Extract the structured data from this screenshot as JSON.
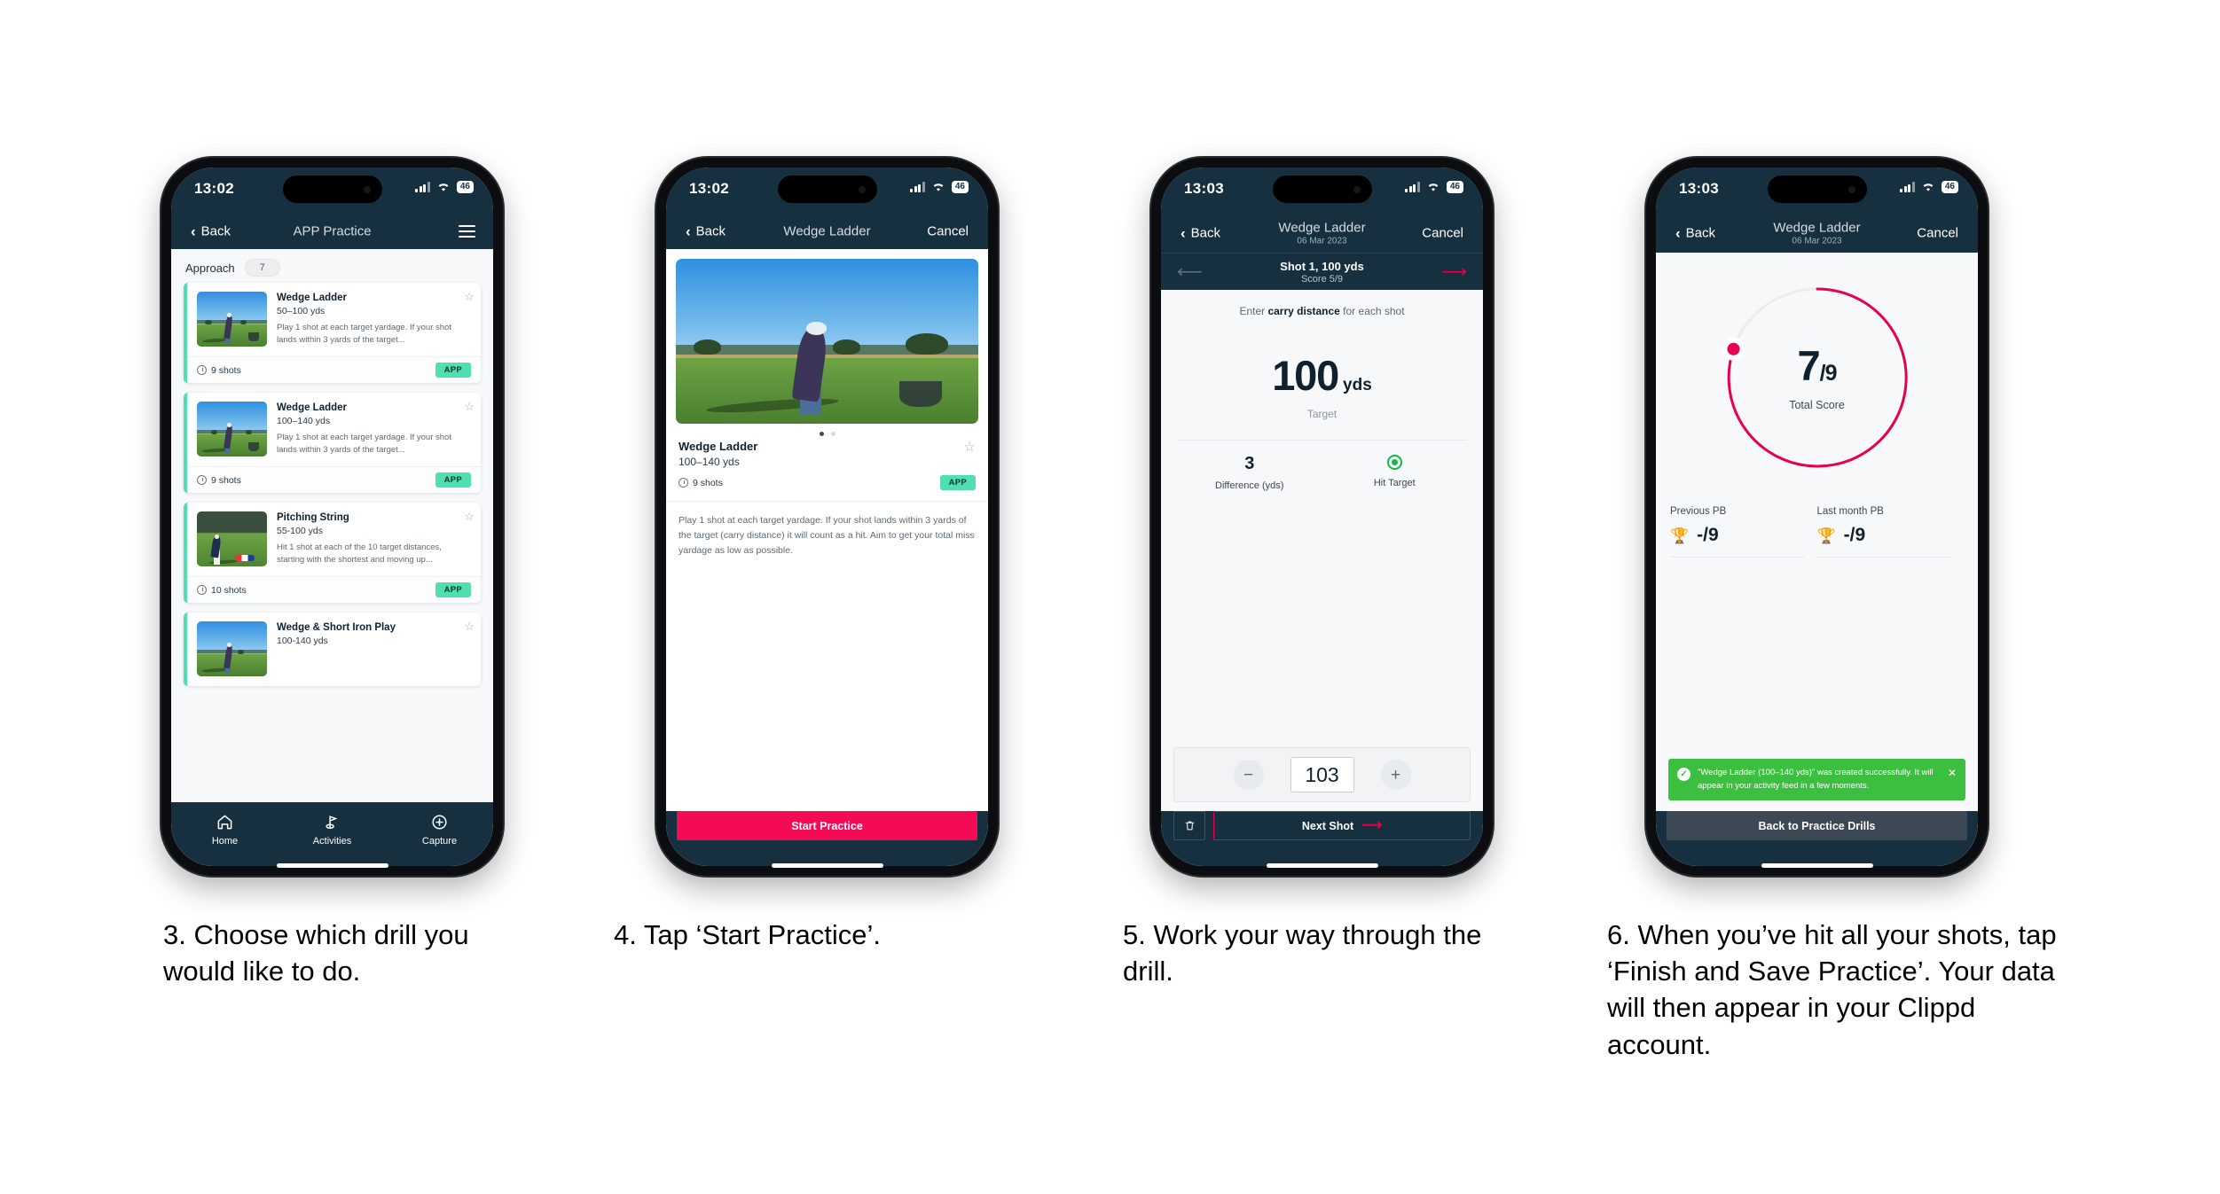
{
  "phones": [
    {
      "id": "phone-1",
      "status": {
        "time": "13:02",
        "battery": "46"
      },
      "nav": {
        "back": "Back",
        "title": "APP Practice",
        "menu_icon": "hamburger-menu-icon"
      },
      "category": {
        "label": "Approach",
        "count": "7"
      },
      "cards": [
        {
          "title": "Wedge Ladder",
          "yardage": "50–100 yds",
          "description": "Play 1 shot at each target yardage. If your shot lands within 3 yards of the target...",
          "shots": "9 shots",
          "tag": "APP"
        },
        {
          "title": "Wedge Ladder",
          "yardage": "100–140 yds",
          "description": "Play 1 shot at each target yardage. If your shot lands within 3 yards of the target...",
          "shots": "9 shots",
          "tag": "APP"
        },
        {
          "title": "Pitching String",
          "yardage": "55-100 yds",
          "description": "Hit 1 shot at each of the 10 target distances, starting with the shortest and moving up...",
          "shots": "10 shots",
          "tag": "APP"
        },
        {
          "title": "Wedge & Short Iron Play",
          "yardage": "100-140 yds",
          "description": "",
          "shots": "",
          "tag": ""
        }
      ],
      "tabs": [
        {
          "label": "Home",
          "icon": "home-icon"
        },
        {
          "label": "Activities",
          "icon": "golf-flag-icon"
        },
        {
          "label": "Capture",
          "icon": "plus-circle-icon"
        }
      ]
    },
    {
      "id": "phone-2",
      "status": {
        "time": "13:02",
        "battery": "46"
      },
      "nav": {
        "back": "Back",
        "title": "Wedge Ladder",
        "cancel": "Cancel"
      },
      "drill": {
        "title": "Wedge Ladder",
        "yardage": "100–140 yds",
        "shots": "9 shots",
        "tag": "APP",
        "description": "Play 1 shot at each target yardage. If your shot lands within 3 yards of the target (carry distance) it will count as a hit. Aim to get your total miss yardage as low as possible."
      },
      "cta": "Start Practice"
    },
    {
      "id": "phone-3",
      "status": {
        "time": "13:03",
        "battery": "46"
      },
      "nav": {
        "back": "Back",
        "title": "Wedge Ladder",
        "subtitle": "06 Mar 2023",
        "cancel": "Cancel"
      },
      "shotbar": {
        "title": "Shot 1, 100 yds",
        "score": "Score 5/9",
        "prev_icon": "arrow-left-icon",
        "next_icon": "arrow-right-icon"
      },
      "hint_prefix": "Enter ",
      "hint_bold": "carry distance",
      "hint_suffix": " for each shot",
      "target": {
        "value": "100",
        "unit": "yds",
        "caption": "Target"
      },
      "stats": [
        {
          "value": "3",
          "label": "Difference (yds)"
        },
        {
          "value": "",
          "label": "Hit Target",
          "icon": "hit-target-indicator"
        }
      ],
      "stepper": {
        "minus": "−",
        "value": "103",
        "plus": "+"
      },
      "footer": {
        "delete_icon": "trash-icon",
        "next": "Next Shot",
        "next_icon": "arrow-right-icon"
      }
    },
    {
      "id": "phone-4",
      "status": {
        "time": "13:03",
        "battery": "46"
      },
      "nav": {
        "back": "Back",
        "title": "Wedge Ladder",
        "subtitle": "06 Mar 2023",
        "cancel": "Cancel"
      },
      "result": {
        "score": "7",
        "separator": "/",
        "total": "9",
        "caption": "Total Score",
        "ring_color": "#e6004f",
        "ring_pct": 78
      },
      "pbs": [
        {
          "label": "Previous PB",
          "value": "-/9",
          "icon": "trophy-icon"
        },
        {
          "label": "Last month PB",
          "value": "-/9",
          "icon": "trophy-icon"
        }
      ],
      "toast": {
        "message": "\"Wedge Ladder (100–140 yds)\" was created successfully. It will appear in your activity feed in a few moments.",
        "check_icon": "check-circle-icon",
        "close_icon": "close-icon",
        "color": "#3cbf3f"
      },
      "cta": "Back to Practice Drills"
    }
  ],
  "captions": [
    "3. Choose which drill you would like to do.",
    "4. Tap ‘Start Practice’.",
    "5. Work your way through the drill.",
    "6. When you’ve hit all your shots, tap ‘Finish and Save Practice’. Your data will then appear in your Clippd account."
  ],
  "colors": {
    "navy": "#17303f",
    "pink": "#f50a56",
    "mint": "#4fdfb0",
    "green": "#3cbf3f"
  }
}
